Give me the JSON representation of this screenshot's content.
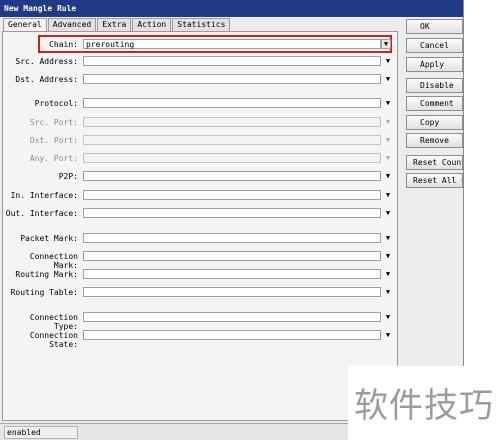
{
  "window": {
    "title": "New Mangle Rule"
  },
  "tabs": [
    {
      "label": "General",
      "active": true
    },
    {
      "label": "Advanced",
      "active": false
    },
    {
      "label": "Extra",
      "active": false
    },
    {
      "label": "Action",
      "active": false
    },
    {
      "label": "Statistics",
      "active": false
    }
  ],
  "chain": {
    "label": "Chain:",
    "value": "prerouting"
  },
  "fields": {
    "src_address": {
      "label": "Src. Address:",
      "value": ""
    },
    "dst_address": {
      "label": "Dst. Address:",
      "value": ""
    },
    "protocol": {
      "label": "Protocol:",
      "value": ""
    },
    "src_port": {
      "label": "Src. Port:",
      "value": "",
      "disabled": true
    },
    "dst_port": {
      "label": "Dst. Port:",
      "value": "",
      "disabled": true
    },
    "any_port": {
      "label": "Any. Port:",
      "value": "",
      "disabled": true
    },
    "p2p": {
      "label": "P2P:",
      "value": ""
    },
    "in_interface": {
      "label": "In. Interface:",
      "value": ""
    },
    "out_interface": {
      "label": "Out. Interface:",
      "value": ""
    },
    "packet_mark": {
      "label": "Packet Mark:",
      "value": ""
    },
    "connection_mark": {
      "label": "Connection Mark:",
      "value": ""
    },
    "routing_mark": {
      "label": "Routing Mark:",
      "value": ""
    },
    "routing_table": {
      "label": "Routing Table:",
      "value": ""
    },
    "connection_type": {
      "label": "Connection Type:",
      "value": ""
    },
    "connection_state": {
      "label": "Connection State:",
      "value": ""
    }
  },
  "buttons": {
    "ok": "OK",
    "cancel": "Cancel",
    "apply": "Apply",
    "disable": "Disable",
    "comment": "Comment",
    "copy": "Copy",
    "remove": "Remove",
    "reset_counters": "Reset Counters",
    "reset_all_counters": "Reset All Counters"
  },
  "status": {
    "text": "enabled"
  },
  "watermark": {
    "text": "软件技巧"
  },
  "icons": {
    "dropdown": "▼",
    "dropdown_alt": "▼"
  },
  "colors": {
    "title_bar": "#1f3a86",
    "highlight": "#d41f1f"
  }
}
